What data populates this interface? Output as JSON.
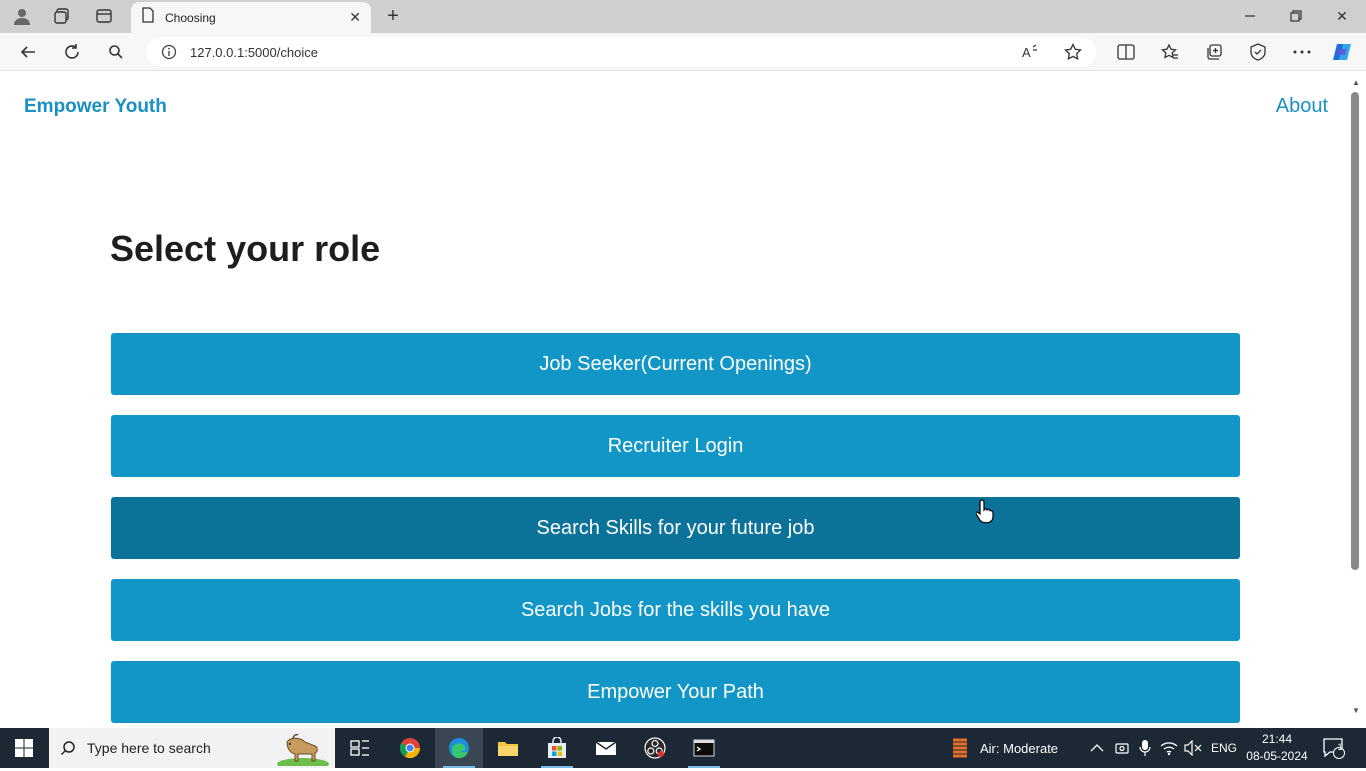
{
  "browser": {
    "tab_title": "Choosing",
    "url": "127.0.0.1:5000/choice"
  },
  "page": {
    "brand": "Empower Youth",
    "nav_about": "About",
    "heading": "Select your role",
    "buttons": [
      "Job Seeker(Current Openings)",
      "Recruiter Login",
      "Search Skills for your future job",
      "Search Jobs for the skills you have",
      "Empower Your Path"
    ],
    "colors": {
      "accent": "#1b8fc0",
      "button": "#1196c7",
      "button_hover": "#0b7299"
    }
  },
  "taskbar": {
    "search_placeholder": "Type here to search",
    "weather": "Air: Moderate",
    "language": "ENG",
    "time": "21:44",
    "date": "08-05-2024",
    "notification_count": "1"
  }
}
